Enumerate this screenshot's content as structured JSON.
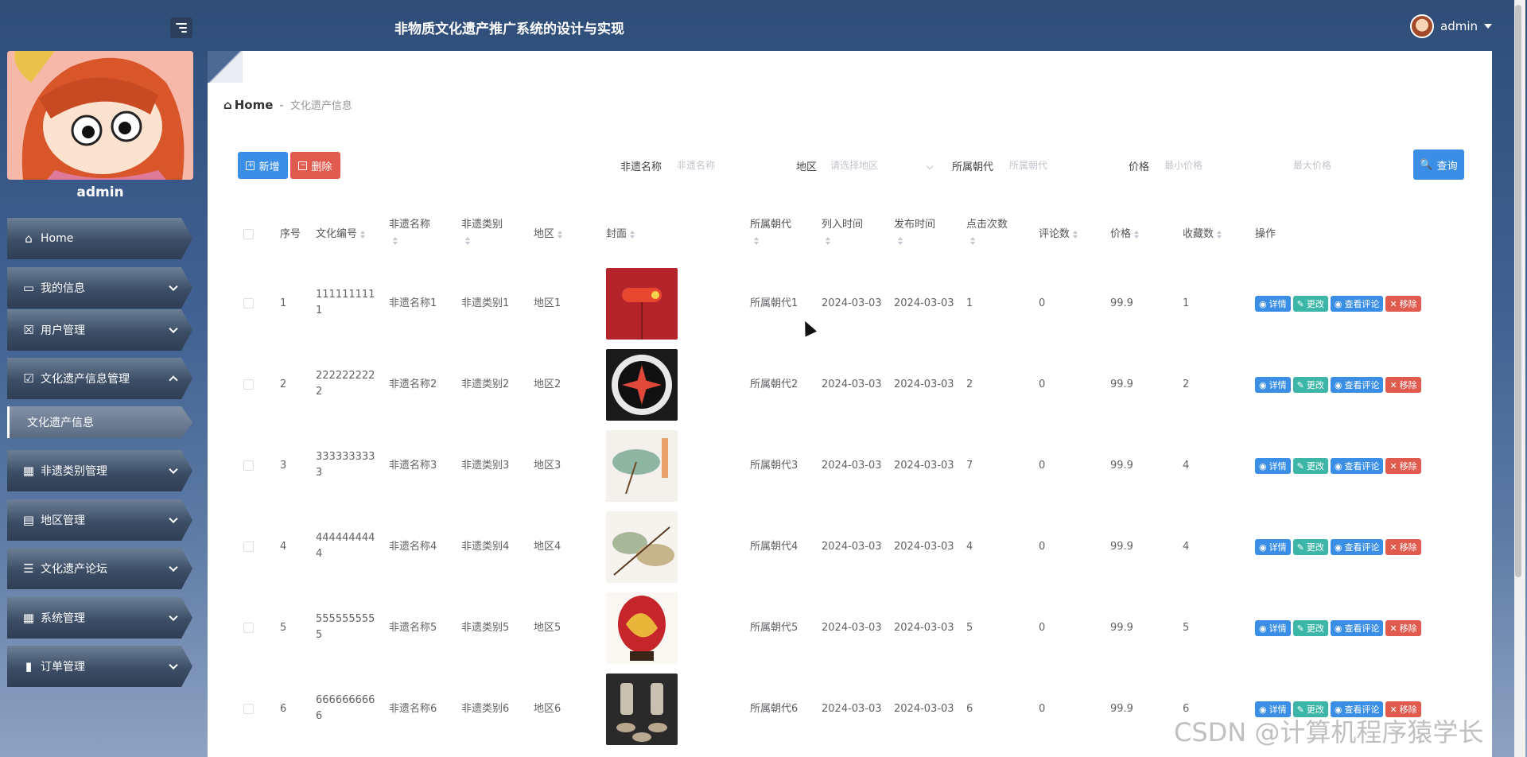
{
  "header": {
    "title": "非物质文化遗产推广系统的设计与实现",
    "user": "admin"
  },
  "sidebar": {
    "username": "admin",
    "items": [
      {
        "label": "Home"
      },
      {
        "label": "我的信息"
      },
      {
        "label": "用户管理"
      },
      {
        "label": "文化遗产信息管理"
      },
      {
        "label": "文化遗产信息"
      },
      {
        "label": "非遗类别管理"
      },
      {
        "label": "地区管理"
      },
      {
        "label": "文化遗产论坛"
      },
      {
        "label": "系统管理"
      },
      {
        "label": "订单管理"
      }
    ]
  },
  "breadcrumb": {
    "home": "Home",
    "sep": "-",
    "current": "文化遗产信息"
  },
  "toolbar": {
    "add": "新增",
    "delete": "删除",
    "query": "查询"
  },
  "search": {
    "name_label": "非遗名称",
    "name_placeholder": "非遗名称",
    "region_label": "地区",
    "region_placeholder": "请选择地区",
    "dynasty_label": "所属朝代",
    "dynasty_placeholder": "所属朝代",
    "price_label": "价格",
    "min_price_placeholder": "最小价格",
    "max_price_placeholder": "最大价格"
  },
  "table": {
    "headers": {
      "index": "序号",
      "code": "文化编号",
      "name": "非遗名称",
      "category": "非遗类别",
      "region": "地区",
      "cover": "封面",
      "dynasty": "所属朝代",
      "listed": "列入时间",
      "published": "发布时间",
      "clicks": "点击次数",
      "comments": "评论数",
      "price": "价格",
      "favorites": "收藏数",
      "actions": "操作"
    },
    "actions": {
      "detail": "详情",
      "edit": "更改",
      "comments": "查看评论",
      "remove": "移除"
    },
    "rows": [
      {
        "index": "1",
        "code1": "111111111",
        "code2": "1",
        "name": "非遗名称1",
        "category": "非遗类别1",
        "region": "地区1",
        "dynasty": "所属朝代1",
        "listed": "2024-03-03",
        "published": "2024-03-03",
        "clicks": "1",
        "comments": "0",
        "price": "99.9",
        "favorites": "1"
      },
      {
        "index": "2",
        "code1": "222222222",
        "code2": "2",
        "name": "非遗名称2",
        "category": "非遗类别2",
        "region": "地区2",
        "dynasty": "所属朝代2",
        "listed": "2024-03-03",
        "published": "2024-03-03",
        "clicks": "2",
        "comments": "0",
        "price": "99.9",
        "favorites": "2"
      },
      {
        "index": "3",
        "code1": "333333333",
        "code2": "3",
        "name": "非遗名称3",
        "category": "非遗类别3",
        "region": "地区3",
        "dynasty": "所属朝代3",
        "listed": "2024-03-03",
        "published": "2024-03-03",
        "clicks": "7",
        "comments": "0",
        "price": "99.9",
        "favorites": "4"
      },
      {
        "index": "4",
        "code1": "444444444",
        "code2": "4",
        "name": "非遗名称4",
        "category": "非遗类别4",
        "region": "地区4",
        "dynasty": "所属朝代4",
        "listed": "2024-03-03",
        "published": "2024-03-03",
        "clicks": "4",
        "comments": "0",
        "price": "99.9",
        "favorites": "4"
      },
      {
        "index": "5",
        "code1": "555555555",
        "code2": "5",
        "name": "非遗名称5",
        "category": "非遗类别5",
        "region": "地区5",
        "dynasty": "所属朝代5",
        "listed": "2024-03-03",
        "published": "2024-03-03",
        "clicks": "5",
        "comments": "0",
        "price": "99.9",
        "favorites": "5"
      },
      {
        "index": "6",
        "code1": "666666666",
        "code2": "6",
        "name": "非遗名称6",
        "category": "非遗类别6",
        "region": "地区6",
        "dynasty": "所属朝代6",
        "listed": "2024-03-03",
        "published": "2024-03-03",
        "clicks": "6",
        "comments": "0",
        "price": "99.9",
        "favorites": "6"
      }
    ]
  },
  "watermark": "CSDN @计算机程序猿学长"
}
